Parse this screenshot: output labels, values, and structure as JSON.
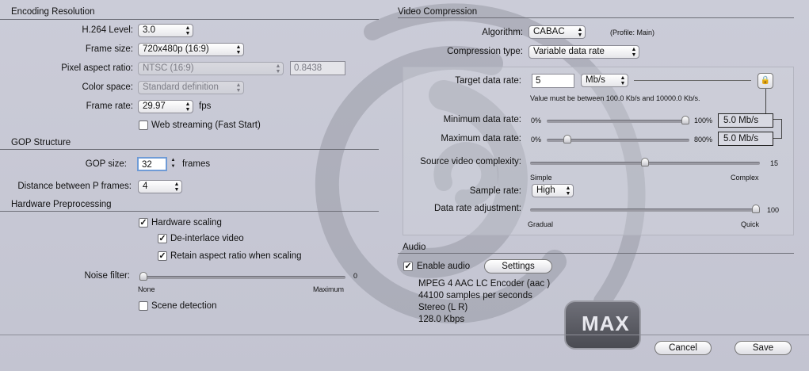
{
  "encoding": {
    "section_title": "Encoding Resolution",
    "h264_label": "H.264 Level:",
    "h264_value": "3.0",
    "frame_size_label": "Frame size:",
    "frame_size_value": "720x480p (16:9)",
    "pixel_aspect_label": "Pixel aspect ratio:",
    "pixel_aspect_value": "NTSC (16:9)",
    "pixel_aspect_number": "0.8438",
    "color_space_label": "Color space:",
    "color_space_value": "Standard definition",
    "frame_rate_label": "Frame rate:",
    "frame_rate_value": "29.97",
    "frame_rate_unit": "fps",
    "web_streaming_label": "Web streaming (Fast Start)",
    "web_streaming_checked": false
  },
  "gop": {
    "section_title": "GOP Structure",
    "gop_size_label": "GOP size:",
    "gop_size_value": "32",
    "gop_unit": "frames",
    "distance_label": "Distance between P frames:",
    "distance_value": "4"
  },
  "hardware": {
    "section_title": "Hardware Preprocessing",
    "scaling_label": "Hardware scaling",
    "scaling_checked": true,
    "deinterlace_label": "De-interlace video",
    "deinterlace_checked": true,
    "retain_label": "Retain aspect ratio when scaling",
    "retain_checked": true,
    "noise_label": "Noise filter:",
    "noise_value": "0",
    "noise_level": 0,
    "noise_min": "None",
    "noise_max": "Maximum",
    "scene_label": "Scene detection",
    "scene_checked": false
  },
  "video": {
    "section_title": "Video Compression",
    "algorithm_label": "Algorithm:",
    "algorithm_value": "CABAC",
    "profile_note": "(Profile: Main)",
    "compression_label": "Compression type:",
    "compression_value": "Variable data rate",
    "target_label": "Target data rate:",
    "target_value": "5",
    "target_unit": "Mb/s",
    "target_hint": "Value must be between 100.0 Kb/s and 10000.0 Kb/s.",
    "min_label": "Minimum data rate:",
    "min_left": "0%",
    "min_right": "100%",
    "min_value": "5.0 Mb/s",
    "min_level": 1.0,
    "max_label": "Maximum data rate:",
    "max_left": "0%",
    "max_right": "800%",
    "max_value": "5.0 Mb/s",
    "max_level": 0.125,
    "complexity_label": "Source video complexity:",
    "complexity_value": "15",
    "complexity_min": "Simple",
    "complexity_max": "Complex",
    "complexity_level": 0.5,
    "sample_label": "Sample rate:",
    "sample_value": "High",
    "adjust_label": "Data rate adjustment:",
    "adjust_value": "100",
    "adjust_min": "Gradual",
    "adjust_max": "Quick",
    "adjust_level": 1.0
  },
  "audio": {
    "section_title": "Audio",
    "enable_label": "Enable audio",
    "enable_checked": true,
    "settings_label": "Settings",
    "line1": "MPEG 4 AAC LC Encoder (aac )",
    "line2": "44100 samples per seconds",
    "line3": "Stereo (L R)",
    "line4": "128.0 Kbps"
  },
  "logo": {
    "text": "MAX"
  },
  "footer": {
    "cancel_label": "Cancel",
    "save_label": "Save"
  }
}
